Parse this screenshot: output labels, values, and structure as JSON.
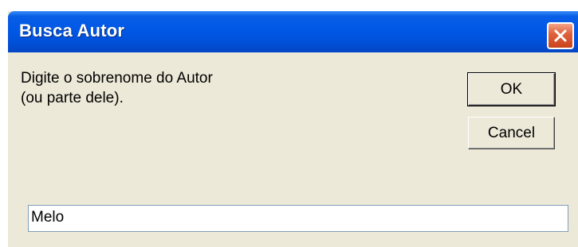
{
  "window": {
    "title": "Busca Autor"
  },
  "prompt": {
    "line1": "Digite o sobrenome do Autor",
    "line2": "(ou parte dele)."
  },
  "buttons": {
    "ok_label": "OK",
    "cancel_label": "Cancel"
  },
  "input": {
    "value": "Melo"
  },
  "icons": {
    "close": "close-icon"
  },
  "colors": {
    "titlebar": "#0058e6",
    "dialog_bg": "#ece9d8",
    "close_button": "#e0633e"
  }
}
